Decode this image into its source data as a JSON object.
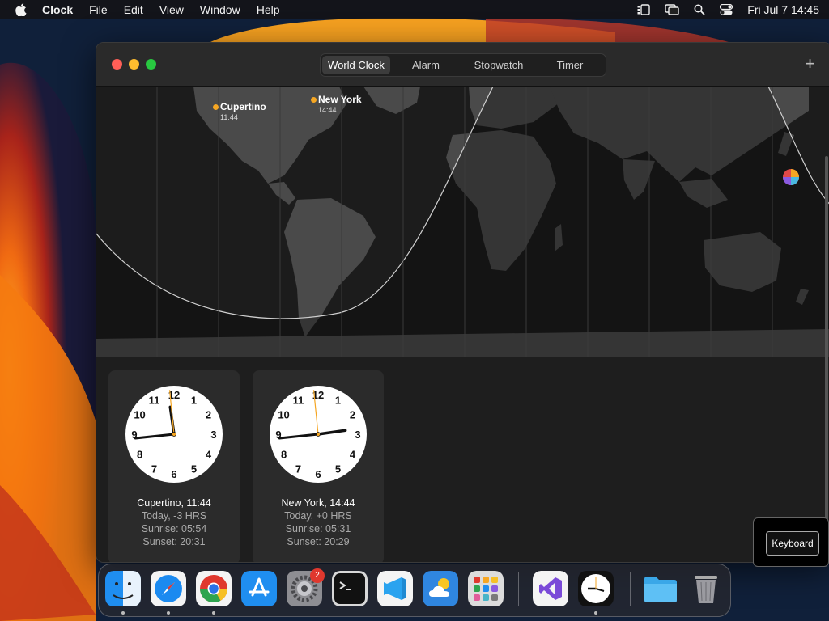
{
  "menubar": {
    "app_name": "Clock",
    "items": [
      "File",
      "Edit",
      "View",
      "Window",
      "Help"
    ],
    "datetime": "Fri Jul 7  14:45"
  },
  "tabs": [
    "World Clock",
    "Alarm",
    "Stopwatch",
    "Timer"
  ],
  "active_tab": "World Clock",
  "add_label": "+",
  "map_cities": [
    {
      "name": "Cupertino",
      "time": "11:44"
    },
    {
      "name": "New York",
      "time": "14:44"
    }
  ],
  "clocks": [
    {
      "title": "Cupertino, 11:44",
      "offset": "Today, -3 HRS",
      "sunrise": "Sunrise: 05:54",
      "sunset": "Sunset: 20:31",
      "hour": 11,
      "minute": 44
    },
    {
      "title": "New York, 14:44",
      "offset": "Today, +0 HRS",
      "sunrise": "Sunrise: 05:31",
      "sunset": "Sunset: 20:29",
      "hour": 14,
      "minute": 44
    }
  ],
  "clock_numbers": [
    "12",
    "1",
    "2",
    "3",
    "4",
    "5",
    "6",
    "7",
    "8",
    "9",
    "10",
    "11"
  ],
  "keyboard_label": "Keyboard",
  "dock": {
    "items": [
      "finder",
      "safari",
      "chrome",
      "app-store",
      "system-settings",
      "terminal",
      "vscode",
      "weather",
      "launchpad",
      "visual-studio",
      "clock",
      "folder",
      "trash"
    ],
    "settings_badge": "2"
  },
  "colors": {
    "accent_dot": "#f5a623",
    "close": "#ff5f57",
    "minimize": "#febc2e",
    "maximize": "#28c840"
  }
}
